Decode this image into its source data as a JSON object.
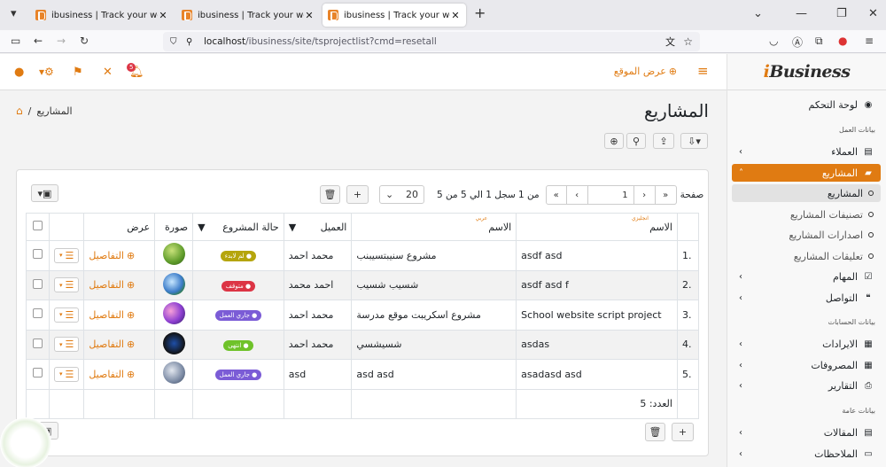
{
  "browser": {
    "tabs": [
      {
        "title": "ibusiness | Track your work with"
      },
      {
        "title": "ibusiness | Track your work with"
      },
      {
        "title": "ibusiness | Track your work with"
      }
    ],
    "url_host": "localhost",
    "url_path": "/ibusiness/site/tsprojectlist?cmd=resetall"
  },
  "logo": {
    "prefix": "i",
    "text": "Business"
  },
  "topnav": {
    "site_link": "عرض الموقع",
    "notif_count": "5"
  },
  "breadcrumb": {
    "current": "المشاريع"
  },
  "page_title": "المشاريع",
  "sidebar": {
    "dashboard": "لوحة التحكم",
    "section_work": "بيانات العمل",
    "clients": "العملاء",
    "projects": "المشاريع",
    "sub_projects": "المشاريع",
    "sub_categories": "تصنيفات المشاريع",
    "sub_versions": "اصدارات المشاريع",
    "sub_comments": "تعليقات المشاريع",
    "tasks": "المهام",
    "communication": "التواصل",
    "section_accounts": "بيانات الحسابات",
    "revenues": "الايرادات",
    "expenses": "المصروفات",
    "reports": "التقارير",
    "section_general": "بيانات عامة",
    "articles": "المقالات",
    "notes": "الملاحظات"
  },
  "pager": {
    "page_label": "صفحة",
    "page_value": "1",
    "of_label": "من 1",
    "records": "سجل 1 الي 5 من 5",
    "page_size": "20"
  },
  "table": {
    "headers": {
      "name_ar": "الاسم",
      "name_ar_sub": "عربي",
      "name_en": "الاسم",
      "name_en_sub": "انجليزي",
      "client": "العميل",
      "status": "حالة المشروع",
      "image": "صورة",
      "view": "عرض"
    },
    "rows": [
      {
        "num": "1.",
        "name_en": "asdf asd",
        "name_ar": "مشروع سنيبتسيبنب",
        "client": "محمد احمد",
        "status": "لم لابدء",
        "details": "التفاصيل"
      },
      {
        "num": "2.",
        "name_en": "asdf asd f",
        "name_ar": "شسيب شسيب",
        "client": "احمد محمد",
        "status": "متوقف",
        "details": "التفاصيل"
      },
      {
        "num": "3.",
        "name_en": "School website script project",
        "name_ar": "مشروع اسكريبت موقع مدرسة",
        "client": "محمد احمد",
        "status": "جاري العمل",
        "details": "التفاصيل"
      },
      {
        "num": "4.",
        "name_en": "asdas",
        "name_ar": "شسيشسي",
        "client": "محمد احمد",
        "status": "انتهى",
        "details": "التفاصيل"
      },
      {
        "num": "5.",
        "name_en": "asadasd asd",
        "name_ar": "asd asd",
        "client": "asd",
        "status": "جاري العمل",
        "details": "التفاصيل"
      }
    ],
    "count_label": "العدد: 5"
  },
  "colors": {
    "accent": "#e07b12",
    "status_notstarted": "#b5a50d",
    "status_stopped": "#dc3545",
    "status_working": "#7b5cd6",
    "status_done": "#6fc22a"
  }
}
